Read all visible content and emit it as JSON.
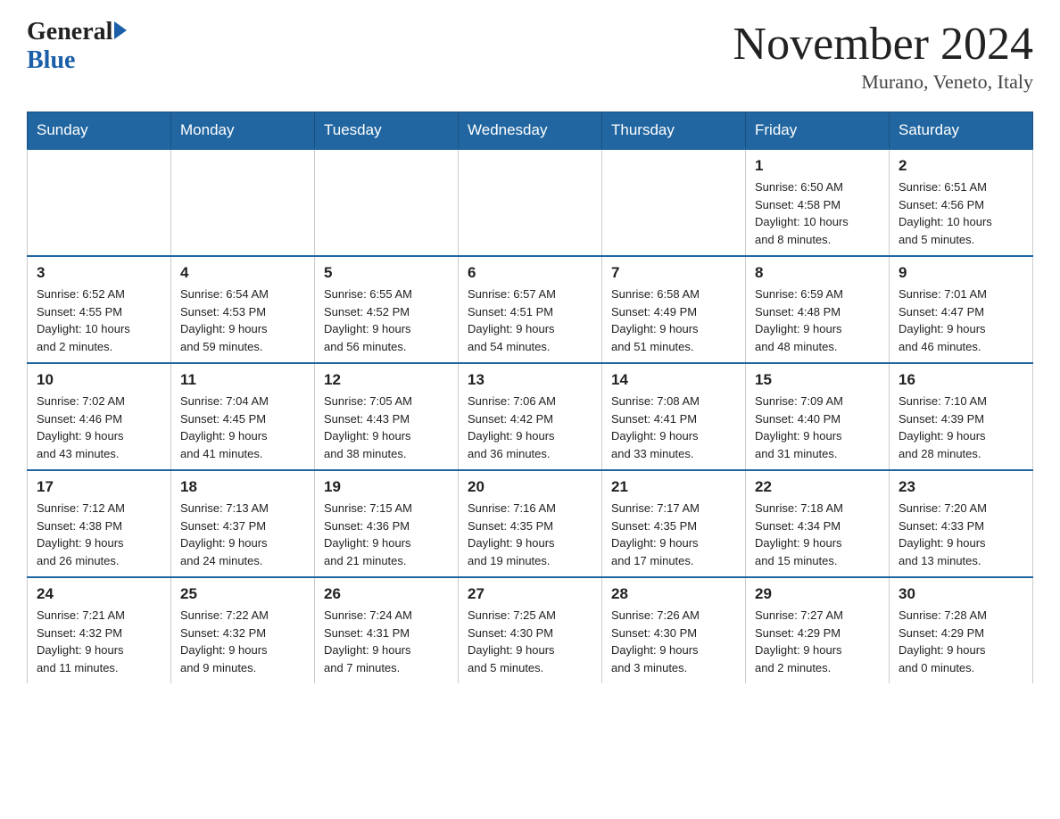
{
  "header": {
    "logo_general": "General",
    "logo_blue": "Blue",
    "title": "November 2024",
    "subtitle": "Murano, Veneto, Italy"
  },
  "days_of_week": [
    "Sunday",
    "Monday",
    "Tuesday",
    "Wednesday",
    "Thursday",
    "Friday",
    "Saturday"
  ],
  "weeks": [
    {
      "days": [
        {
          "num": "",
          "info": ""
        },
        {
          "num": "",
          "info": ""
        },
        {
          "num": "",
          "info": ""
        },
        {
          "num": "",
          "info": ""
        },
        {
          "num": "",
          "info": ""
        },
        {
          "num": "1",
          "info": "Sunrise: 6:50 AM\nSunset: 4:58 PM\nDaylight: 10 hours\nand 8 minutes."
        },
        {
          "num": "2",
          "info": "Sunrise: 6:51 AM\nSunset: 4:56 PM\nDaylight: 10 hours\nand 5 minutes."
        }
      ]
    },
    {
      "days": [
        {
          "num": "3",
          "info": "Sunrise: 6:52 AM\nSunset: 4:55 PM\nDaylight: 10 hours\nand 2 minutes."
        },
        {
          "num": "4",
          "info": "Sunrise: 6:54 AM\nSunset: 4:53 PM\nDaylight: 9 hours\nand 59 minutes."
        },
        {
          "num": "5",
          "info": "Sunrise: 6:55 AM\nSunset: 4:52 PM\nDaylight: 9 hours\nand 56 minutes."
        },
        {
          "num": "6",
          "info": "Sunrise: 6:57 AM\nSunset: 4:51 PM\nDaylight: 9 hours\nand 54 minutes."
        },
        {
          "num": "7",
          "info": "Sunrise: 6:58 AM\nSunset: 4:49 PM\nDaylight: 9 hours\nand 51 minutes."
        },
        {
          "num": "8",
          "info": "Sunrise: 6:59 AM\nSunset: 4:48 PM\nDaylight: 9 hours\nand 48 minutes."
        },
        {
          "num": "9",
          "info": "Sunrise: 7:01 AM\nSunset: 4:47 PM\nDaylight: 9 hours\nand 46 minutes."
        }
      ]
    },
    {
      "days": [
        {
          "num": "10",
          "info": "Sunrise: 7:02 AM\nSunset: 4:46 PM\nDaylight: 9 hours\nand 43 minutes."
        },
        {
          "num": "11",
          "info": "Sunrise: 7:04 AM\nSunset: 4:45 PM\nDaylight: 9 hours\nand 41 minutes."
        },
        {
          "num": "12",
          "info": "Sunrise: 7:05 AM\nSunset: 4:43 PM\nDaylight: 9 hours\nand 38 minutes."
        },
        {
          "num": "13",
          "info": "Sunrise: 7:06 AM\nSunset: 4:42 PM\nDaylight: 9 hours\nand 36 minutes."
        },
        {
          "num": "14",
          "info": "Sunrise: 7:08 AM\nSunset: 4:41 PM\nDaylight: 9 hours\nand 33 minutes."
        },
        {
          "num": "15",
          "info": "Sunrise: 7:09 AM\nSunset: 4:40 PM\nDaylight: 9 hours\nand 31 minutes."
        },
        {
          "num": "16",
          "info": "Sunrise: 7:10 AM\nSunset: 4:39 PM\nDaylight: 9 hours\nand 28 minutes."
        }
      ]
    },
    {
      "days": [
        {
          "num": "17",
          "info": "Sunrise: 7:12 AM\nSunset: 4:38 PM\nDaylight: 9 hours\nand 26 minutes."
        },
        {
          "num": "18",
          "info": "Sunrise: 7:13 AM\nSunset: 4:37 PM\nDaylight: 9 hours\nand 24 minutes."
        },
        {
          "num": "19",
          "info": "Sunrise: 7:15 AM\nSunset: 4:36 PM\nDaylight: 9 hours\nand 21 minutes."
        },
        {
          "num": "20",
          "info": "Sunrise: 7:16 AM\nSunset: 4:35 PM\nDaylight: 9 hours\nand 19 minutes."
        },
        {
          "num": "21",
          "info": "Sunrise: 7:17 AM\nSunset: 4:35 PM\nDaylight: 9 hours\nand 17 minutes."
        },
        {
          "num": "22",
          "info": "Sunrise: 7:18 AM\nSunset: 4:34 PM\nDaylight: 9 hours\nand 15 minutes."
        },
        {
          "num": "23",
          "info": "Sunrise: 7:20 AM\nSunset: 4:33 PM\nDaylight: 9 hours\nand 13 minutes."
        }
      ]
    },
    {
      "days": [
        {
          "num": "24",
          "info": "Sunrise: 7:21 AM\nSunset: 4:32 PM\nDaylight: 9 hours\nand 11 minutes."
        },
        {
          "num": "25",
          "info": "Sunrise: 7:22 AM\nSunset: 4:32 PM\nDaylight: 9 hours\nand 9 minutes."
        },
        {
          "num": "26",
          "info": "Sunrise: 7:24 AM\nSunset: 4:31 PM\nDaylight: 9 hours\nand 7 minutes."
        },
        {
          "num": "27",
          "info": "Sunrise: 7:25 AM\nSunset: 4:30 PM\nDaylight: 9 hours\nand 5 minutes."
        },
        {
          "num": "28",
          "info": "Sunrise: 7:26 AM\nSunset: 4:30 PM\nDaylight: 9 hours\nand 3 minutes."
        },
        {
          "num": "29",
          "info": "Sunrise: 7:27 AM\nSunset: 4:29 PM\nDaylight: 9 hours\nand 2 minutes."
        },
        {
          "num": "30",
          "info": "Sunrise: 7:28 AM\nSunset: 4:29 PM\nDaylight: 9 hours\nand 0 minutes."
        }
      ]
    }
  ]
}
